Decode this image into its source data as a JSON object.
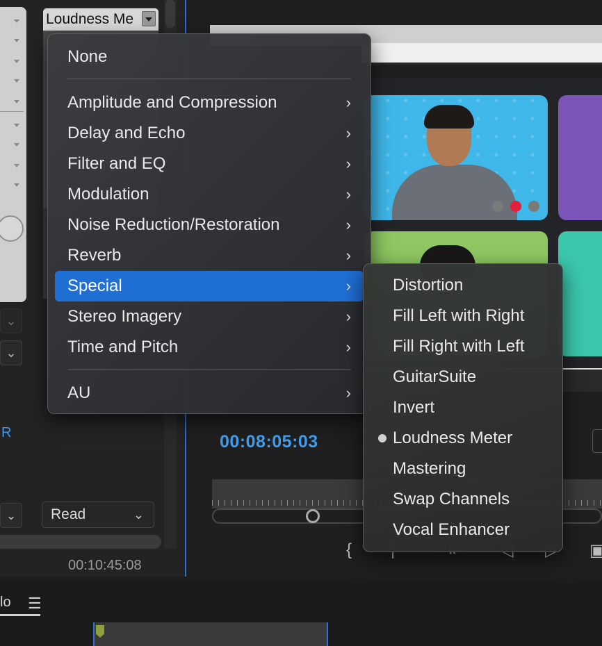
{
  "mixer": {
    "effect_select_value": "Loudness Me",
    "automation_label": "R",
    "automation_mode": "Read",
    "duration": "00:10:45:08"
  },
  "monitor": {
    "timecode": "00:08:05:03"
  },
  "timeline": {
    "tab_label": "lo"
  },
  "menu": {
    "items": [
      {
        "label": "None",
        "has_submenu": false
      },
      {
        "label": "Amplitude and Compression",
        "has_submenu": true
      },
      {
        "label": "Delay and Echo",
        "has_submenu": true
      },
      {
        "label": "Filter and EQ",
        "has_submenu": true
      },
      {
        "label": "Modulation",
        "has_submenu": true
      },
      {
        "label": "Noise Reduction/Restoration",
        "has_submenu": true
      },
      {
        "label": "Reverb",
        "has_submenu": true
      },
      {
        "label": "Special",
        "has_submenu": true,
        "highlighted": true
      },
      {
        "label": "Stereo Imagery",
        "has_submenu": true
      },
      {
        "label": "Time and Pitch",
        "has_submenu": true
      },
      {
        "label": "AU",
        "has_submenu": true
      }
    ],
    "submenu_icon": "chevron-right-icon",
    "highlight_color": "#1f6fd4"
  },
  "submenu": {
    "items": [
      {
        "label": "Distortion"
      },
      {
        "label": "Fill Left with Right"
      },
      {
        "label": "Fill Right with Left"
      },
      {
        "label": "GuitarSuite"
      },
      {
        "label": "Invert"
      },
      {
        "label": "Loudness Meter",
        "selected": true
      },
      {
        "label": "Mastering"
      },
      {
        "label": "Swap Channels"
      },
      {
        "label": "Vocal Enhancer"
      }
    ]
  },
  "colors": {
    "accent_blue": "#3f9ff0",
    "panel_border": "#2d6fd6"
  }
}
